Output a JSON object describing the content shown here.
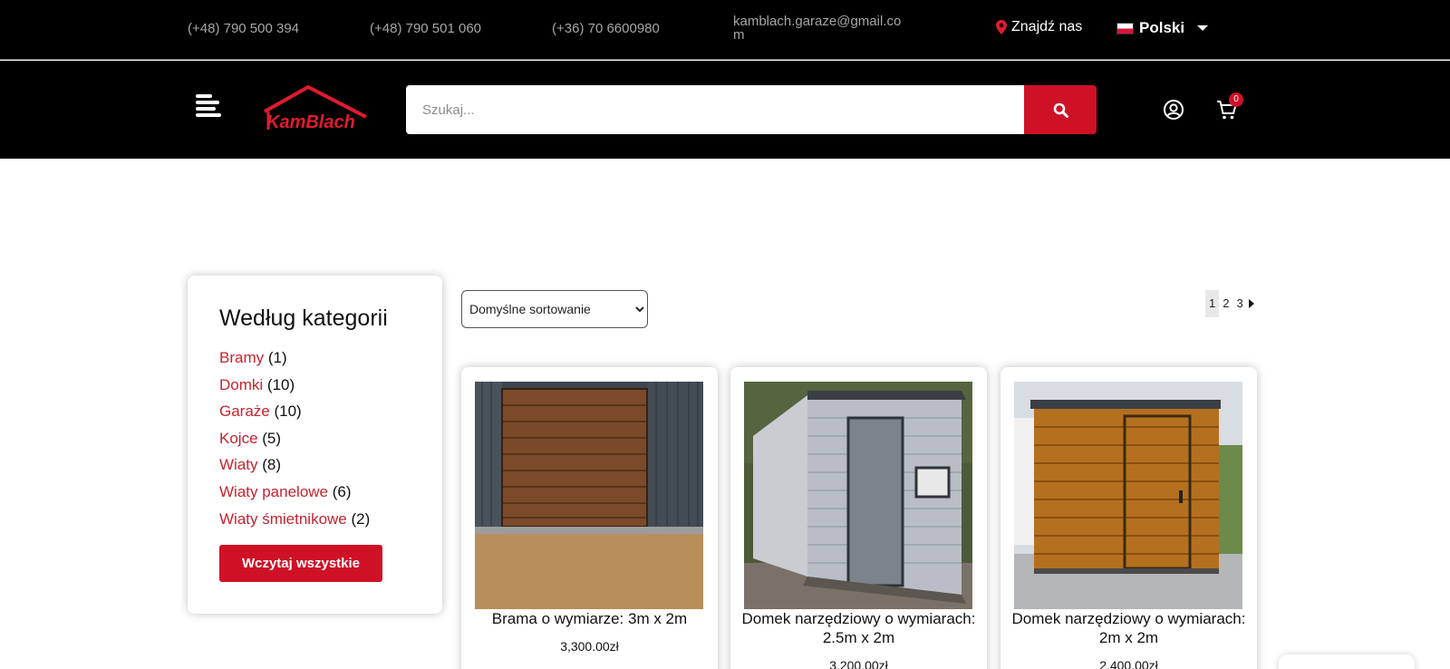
{
  "topbar": {
    "phones": [
      "(+48) 790 500 394",
      "(+48) 790 501 060",
      "(+36) 70 6600980"
    ],
    "email": "kamblach.garaze@gmail.com",
    "find_us": "Znajdź nas",
    "language": "Polski"
  },
  "header": {
    "logo_text": "KamBlach",
    "search_placeholder": "Szukaj...",
    "cart_count": "0"
  },
  "sidebar": {
    "title": "Według kategorii",
    "categories": [
      {
        "name": "Bramy",
        "count": "(1)"
      },
      {
        "name": "Domki",
        "count": "(10)"
      },
      {
        "name": "Garaże",
        "count": "(10)"
      },
      {
        "name": "Kojce",
        "count": "(5)"
      },
      {
        "name": "Wiaty",
        "count": "(8)"
      },
      {
        "name": "Wiaty panelowe",
        "count": "(6)"
      },
      {
        "name": "Wiaty śmietnikowe",
        "count": "(2)"
      }
    ],
    "load_all": "Wczytaj wszystkie"
  },
  "toolbar": {
    "sort_selected": "Domyślne sortowanie",
    "pages": [
      "1",
      "2",
      "3"
    ],
    "current_page": "1"
  },
  "products": [
    {
      "title": "Brama o wymiarze: 3m x 2m",
      "price": "3,300.00zł"
    },
    {
      "title": "Domek narzędziowy o wymiarach:  2.5m x 2m",
      "price": "3,200.00zł"
    },
    {
      "title": "Domek narzędziowy o wymiarach:  2m x 2m",
      "price": "2,400.00zł"
    }
  ],
  "colors": {
    "brand_red": "#cf1126",
    "link_red": "#c9222e",
    "topbar_bg": "#000000",
    "contact_grey": "#a6a6a6"
  },
  "icons": {
    "find_us": "map-pin-icon",
    "menu": "hamburger-menu-icon",
    "search": "search-icon",
    "account": "user-circle-icon",
    "cart": "shopping-cart-icon"
  }
}
